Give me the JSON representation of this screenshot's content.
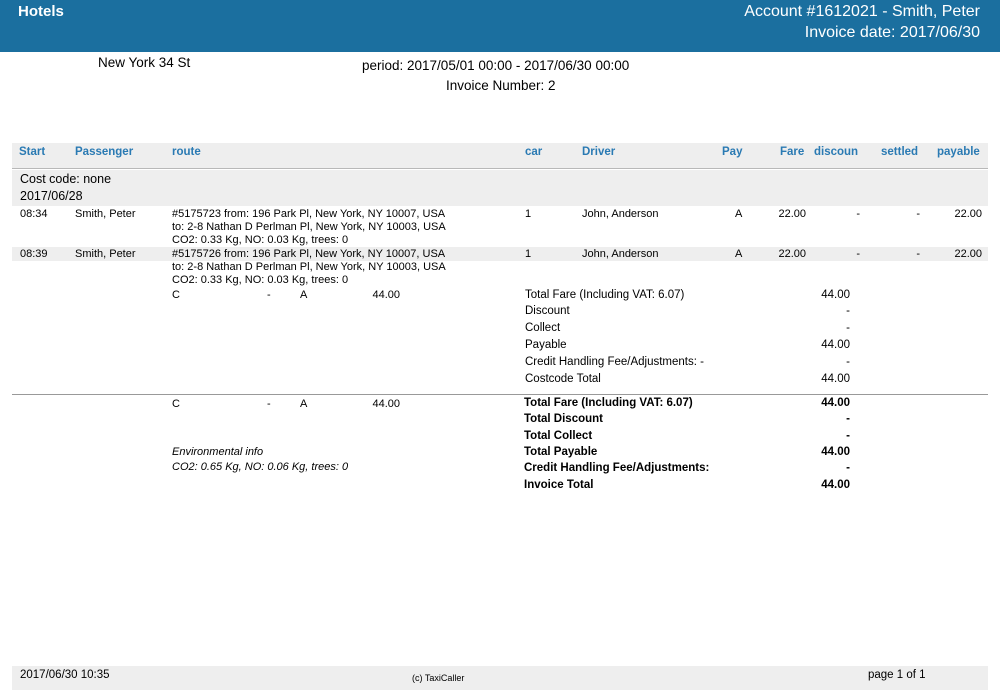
{
  "header": {
    "title": "Hotels",
    "account": "Account #1612021 - Smith, Peter",
    "invoice_date": "Invoice date: 2017/06/30"
  },
  "location": "New York 34 St",
  "period": "period: 2017/05/01 00:00 - 2017/06/30 00:00",
  "invoice_number": "Invoice Number: 2",
  "columns": {
    "start": "Start",
    "passenger": "Passenger",
    "route": "route",
    "car": "car",
    "driver": "Driver",
    "pay": "Pay",
    "fare": "Fare",
    "discount": "discoun",
    "settled": "settled",
    "payable": "payable"
  },
  "cost_code": "Cost code: none",
  "date_group": "2017/06/28",
  "rows": [
    {
      "start": "08:34",
      "passenger": "Smith, Peter",
      "route_from": "#5175723 from: 196 Park Pl, New York, NY 10007, USA",
      "route_to": "to: 2-8 Nathan D Perlman Pl, New York, NY 10003, USA",
      "env": "CO2: 0.33 Kg, NO: 0.03 Kg, trees: 0",
      "car": "1",
      "driver": "John, Anderson",
      "pay": "A",
      "fare": "22.00",
      "discount": "-",
      "settled": "-",
      "payable": "22.00"
    },
    {
      "start": "08:39",
      "passenger": "Smith, Peter",
      "route_from": "#5175726 from: 196 Park Pl, New York, NY 10007, USA",
      "route_to": "to: 2-8 Nathan D Perlman Pl, New York, NY 10003, USA",
      "env": "CO2: 0.33 Kg, NO: 0.03 Kg, trees: 0",
      "car": "1",
      "driver": "John, Anderson",
      "pay": "A",
      "fare": "22.00",
      "discount": "-",
      "settled": "-",
      "payable": "22.00"
    }
  ],
  "costcode_summary": {
    "pay_breakdown": {
      "code": "C",
      "dash": "-",
      "type": "A",
      "amount": "44.00"
    },
    "lines": [
      {
        "label": "Total Fare (Including VAT: 6.07)",
        "value": "44.00"
      },
      {
        "label": "Discount",
        "value": "-"
      },
      {
        "label": "Collect",
        "value": "-"
      },
      {
        "label": "Payable",
        "value": "44.00"
      },
      {
        "label": "Credit Handling Fee/Adjustments: -",
        "value": "-"
      },
      {
        "label": "Costcode Total",
        "value": "44.00"
      }
    ]
  },
  "invoice_summary": {
    "pay_breakdown": {
      "code": "C",
      "dash": "-",
      "type": "A",
      "amount": "44.00"
    },
    "env_title": "Environmental info",
    "env_text": "CO2: 0.65 Kg, NO: 0.06 Kg, trees: 0",
    "lines": [
      {
        "label": "Total Fare (Including VAT: 6.07)",
        "value": "44.00"
      },
      {
        "label": "Total Discount",
        "value": "-"
      },
      {
        "label": "Total Collect",
        "value": "-"
      },
      {
        "label": "Total Payable",
        "value": "44.00"
      },
      {
        "label": "Credit Handling Fee/Adjustments:",
        "value": "-"
      },
      {
        "label": "Invoice Total",
        "value": "44.00"
      }
    ]
  },
  "footer": {
    "timestamp": "2017/06/30 10:35",
    "copyright": "(c) TaxiCaller",
    "page": "page 1 of 1"
  }
}
